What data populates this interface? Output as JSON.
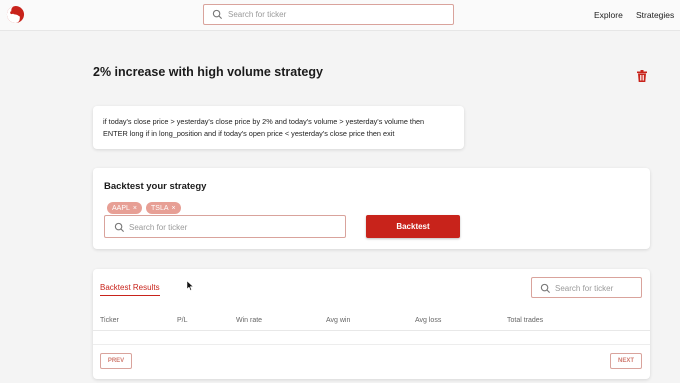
{
  "header": {
    "search_placeholder": "Search for ticker",
    "nav": [
      "Explore",
      "Strategies"
    ]
  },
  "strategy": {
    "title": "2% increase with high volume strategy",
    "description_line1": "if today's close price > yesterday's close price by 2% and today's volume > yesterday's volume then",
    "description_line2": "ENTER long if in long_position and if today's open price < yesterday's close price then exit"
  },
  "backtest": {
    "title": "Backtest your strategy",
    "tickers": [
      "AAPL",
      "TSLA"
    ],
    "chip_remove": "×",
    "search_placeholder": "Search for ticker",
    "button_label": "Backtest"
  },
  "results": {
    "tab_label": "Backtest Results",
    "search_placeholder": "Search for ticker",
    "columns": [
      "Ticker",
      "P/L",
      "Win rate",
      "Avg win",
      "Avg loss",
      "Total trades"
    ],
    "prev_label": "PREV",
    "next_label": "NEXT"
  },
  "colors": {
    "accent": "#c8231b",
    "chip": "#e79f95",
    "border": "#d9a39c"
  }
}
